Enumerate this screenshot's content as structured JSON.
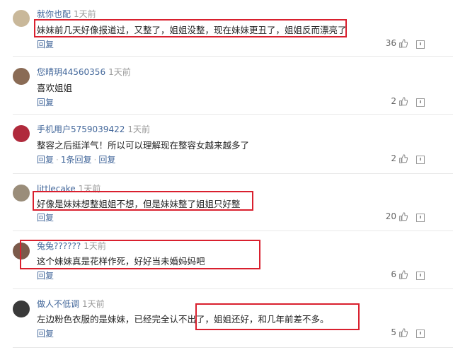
{
  "comments": [
    {
      "user": "就你也配",
      "time": "1天前",
      "text": "妹妹前几天好像报道过，又整了，姐姐没整，现在妹妹更丑了，姐姐反而漂亮了",
      "reply_label": "回复",
      "likes": "36",
      "avatar_color": "#c9b89a"
    },
    {
      "user": "您晴玥44560356",
      "time": "1天前",
      "text": "喜欢姐姐",
      "reply_label": "回复",
      "likes": "2",
      "avatar_color": "#8a6b55"
    },
    {
      "user": "手机用户5759039422",
      "time": "1天前",
      "text": "整容之后挺洋气！所以可以理解现在整容女越来越多了",
      "reply_label": "回复",
      "extra_label": "1条回复",
      "likes": "2",
      "avatar_color": "#b02a3c"
    },
    {
      "user": "littlecake",
      "time": "1天前",
      "text": "好像是妹妹想整姐姐不想，但是妹妹整了姐姐只好整",
      "reply_label": "回复",
      "likes": "20",
      "avatar_color": "#9a8d7a"
    },
    {
      "user": "兔兔??????",
      "time": "1天前",
      "text": "这个妹妹真是花样作死，好好当未婚妈妈吧",
      "reply_label": "回复",
      "likes": "6",
      "avatar_color": "#7b5a4a"
    },
    {
      "user": "做人不低调",
      "time": "1天前",
      "text": "左边粉色衣服的是妹妹，已经完全认不出了，姐姐还好，和几年前差不多。",
      "reply_label": "回复",
      "likes": "5",
      "avatar_color": "#3a3a3a"
    }
  ],
  "colors": {
    "link": "#406599",
    "highlight": "#d9202e",
    "meta": "#9a9a9a"
  },
  "icons": [
    "thumb-up-icon",
    "report-icon",
    "avatar"
  ]
}
